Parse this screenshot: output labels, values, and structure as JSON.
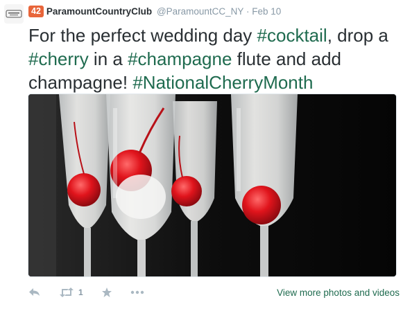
{
  "tweet": {
    "badge": "42",
    "display_name": "ParamountCountryClub",
    "handle": "@ParamountCC_NY",
    "separator": "·",
    "date": "Feb 10",
    "text_parts": {
      "t1": "For the perfect wedding day ",
      "h1": "#cocktail",
      "t2": ", drop a ",
      "h2": "#cherry",
      "t3": " in a ",
      "h3": "#champagne",
      "t4": " flute and add champagne! ",
      "h4": "#NationalCherryMonth"
    }
  },
  "actions": {
    "retweet_count": "1",
    "view_more": "View more photos and videos"
  },
  "colors": {
    "hashtag": "#2b7bb9",
    "link_green": "#1f6b4f",
    "badge": "#e8653a",
    "muted": "#8899a6"
  },
  "icons": {
    "reply": "reply-icon",
    "retweet": "retweet-icon",
    "favorite": "star-icon",
    "more": "ellipsis-icon"
  }
}
